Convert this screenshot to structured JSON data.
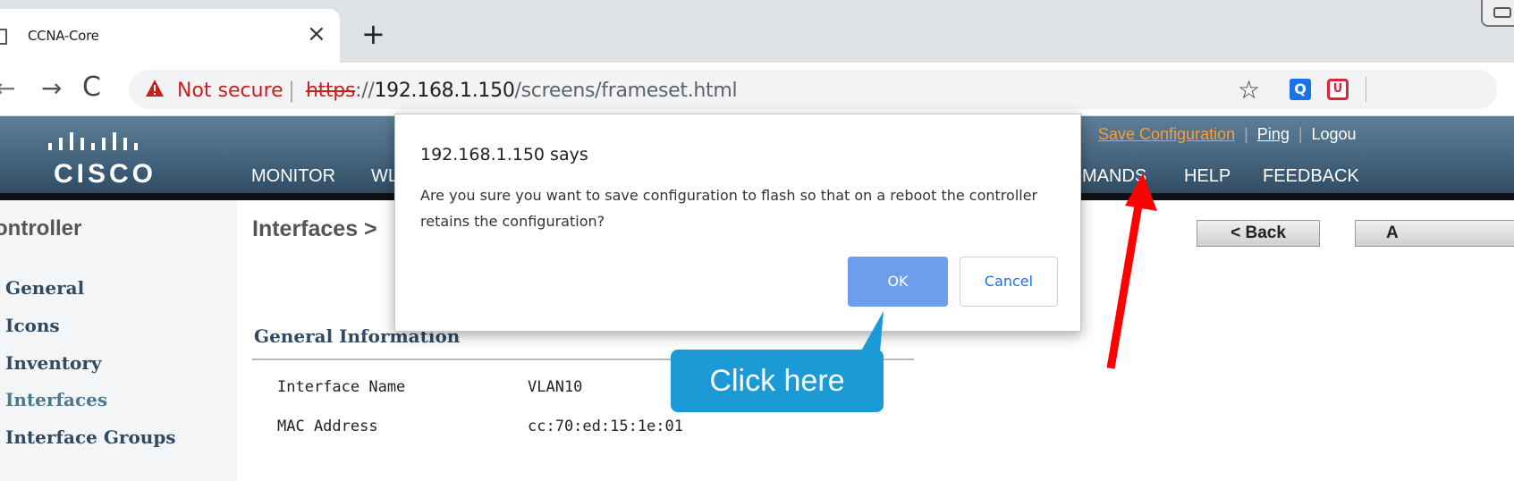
{
  "browser": {
    "tab_title": "CCNA-Core",
    "tab_close": "×",
    "new_tab": "+",
    "nav_back": "←",
    "nav_forward": "→",
    "nav_reload": "C",
    "security_label": "Not secure",
    "url_scheme": "https",
    "url_sep": "://",
    "url_host": "192.168.1.150",
    "url_path": "/screens/frameset.html",
    "bookmark_star": "☆",
    "extension_search": "Q",
    "extension_pocket": "U"
  },
  "cisco": {
    "logo_text": "CISCO",
    "top_links": {
      "save_configuration": "Save Configuration",
      "ping": "Ping",
      "logout": "Logou"
    },
    "menu": {
      "monitor": "MONITOR",
      "wlans_partial": "WL",
      "commands_partial": "MANDS",
      "help": "HELP",
      "feedback": "FEEDBACK"
    },
    "colors": {
      "header": "#4a6a84",
      "save_link": "#ff9c33",
      "nav_text": "#2e4b63"
    }
  },
  "sidebar": {
    "title": "ontroller",
    "items": [
      {
        "label": "General"
      },
      {
        "label": "Icons"
      },
      {
        "label": "Inventory"
      },
      {
        "label": "Interfaces"
      },
      {
        "label": "Interface Groups"
      }
    ]
  },
  "main": {
    "page_title": "Interfaces >",
    "back_button": "< Back",
    "apply_button": "A",
    "section_title": "General Information",
    "fields": [
      {
        "label": "Interface Name",
        "value": "VLAN10"
      },
      {
        "label": "MAC Address",
        "value": "cc:70:ed:15:1e:01"
      }
    ]
  },
  "dialog": {
    "title": "192.168.1.150 says",
    "message": "Are you sure you want to save configuration to flash so that on a reboot the controller retains the configuration?",
    "ok_label": "OK",
    "cancel_label": "Cancel"
  },
  "annotation": {
    "callout_text": "Click here",
    "callout_color": "#1c9ad6",
    "arrow_color": "#ff0000"
  }
}
